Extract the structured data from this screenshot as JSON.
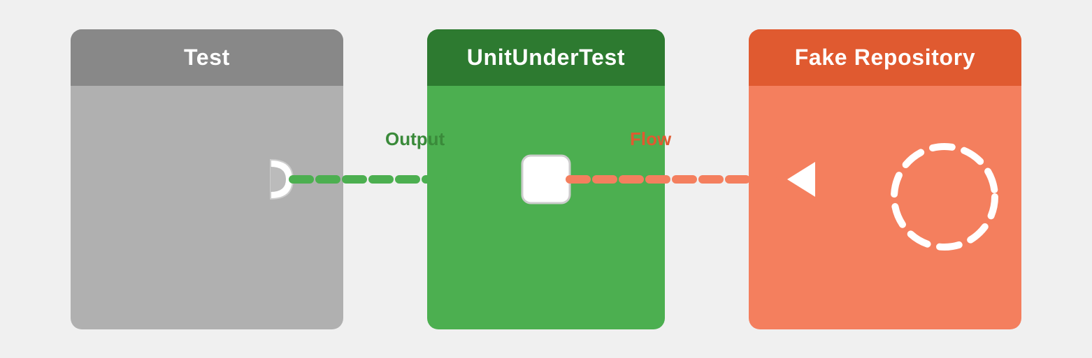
{
  "boxes": {
    "test": {
      "title": "Test",
      "header_bg": "#888888",
      "body_bg": "#b0b0b0"
    },
    "unit": {
      "title": "UnitUnderTest",
      "header_bg": "#2d7a30",
      "body_bg": "#4caf50"
    },
    "fake": {
      "title": "Fake Repository",
      "header_bg": "#e05a30",
      "body_bg": "#f47f5e"
    }
  },
  "labels": {
    "output": "Output",
    "flow": "Flow"
  },
  "colors": {
    "green_line": "#4caf50",
    "orange_line": "#f47f5e",
    "white": "#ffffff",
    "output_label": "#3a8a3a",
    "flow_label": "#e05a30"
  }
}
